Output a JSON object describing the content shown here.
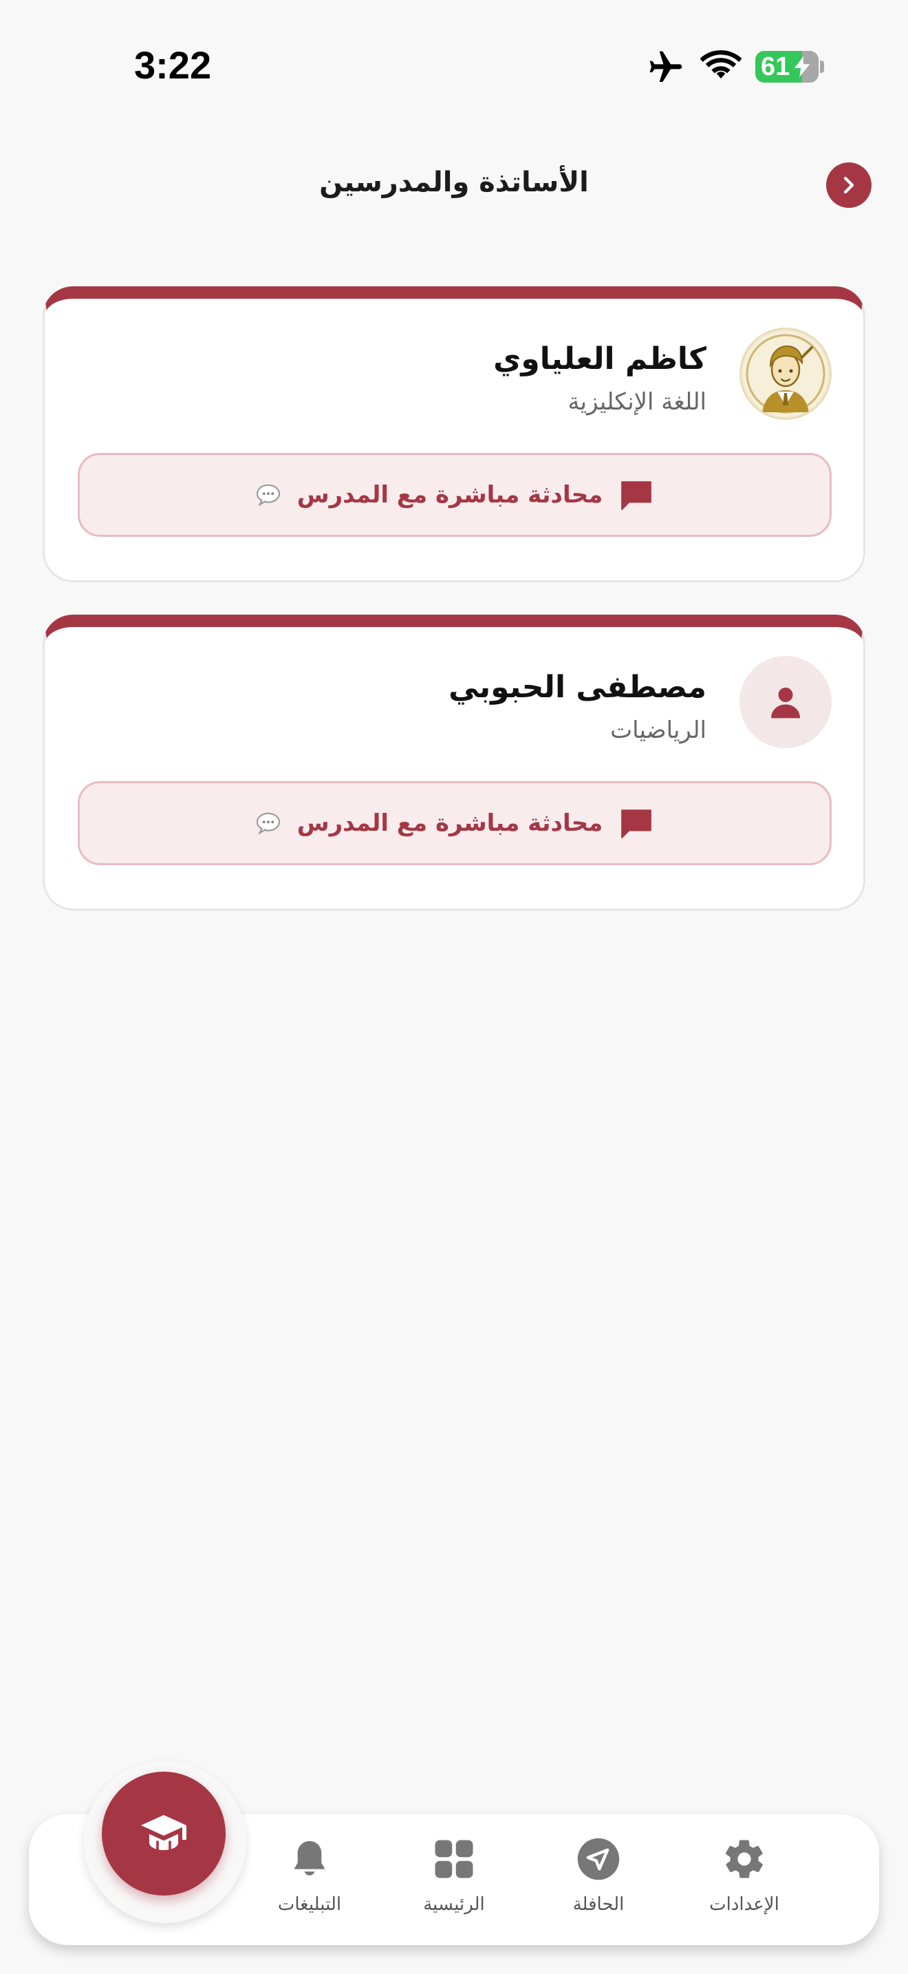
{
  "status_bar": {
    "time": "3:22",
    "battery_percent": "61",
    "icons": [
      "airplane-icon",
      "wifi-icon",
      "battery-charging-icon"
    ]
  },
  "header": {
    "title": "الأساتذة والمدرسين",
    "back_icon": "chevron-right-icon"
  },
  "teachers": [
    {
      "name": "كاظم العلياوي",
      "subject": "اللغة الإنكليزية",
      "avatar": "teacher-illustration",
      "chat_label": "محادثة مباشرة مع المدرس"
    },
    {
      "name": "مصطفى الحبوبي",
      "subject": "الرياضيات",
      "avatar": "person-placeholder-icon",
      "chat_label": "محادثة مباشرة مع المدرس"
    }
  ],
  "bottom_nav": {
    "fab_icon": "graduation-cap-icon",
    "items": [
      {
        "label": "التبليغات",
        "icon": "bell-icon"
      },
      {
        "label": "الرئيسية",
        "icon": "grid-icon"
      },
      {
        "label": "الحافلة",
        "icon": "navigation-arrow-icon"
      },
      {
        "label": "الإعدادات",
        "icon": "gear-icon"
      }
    ]
  },
  "colors": {
    "brand": "#a53744",
    "chat_bg": "#f8eced",
    "page_bg": "#f8f8f8"
  }
}
